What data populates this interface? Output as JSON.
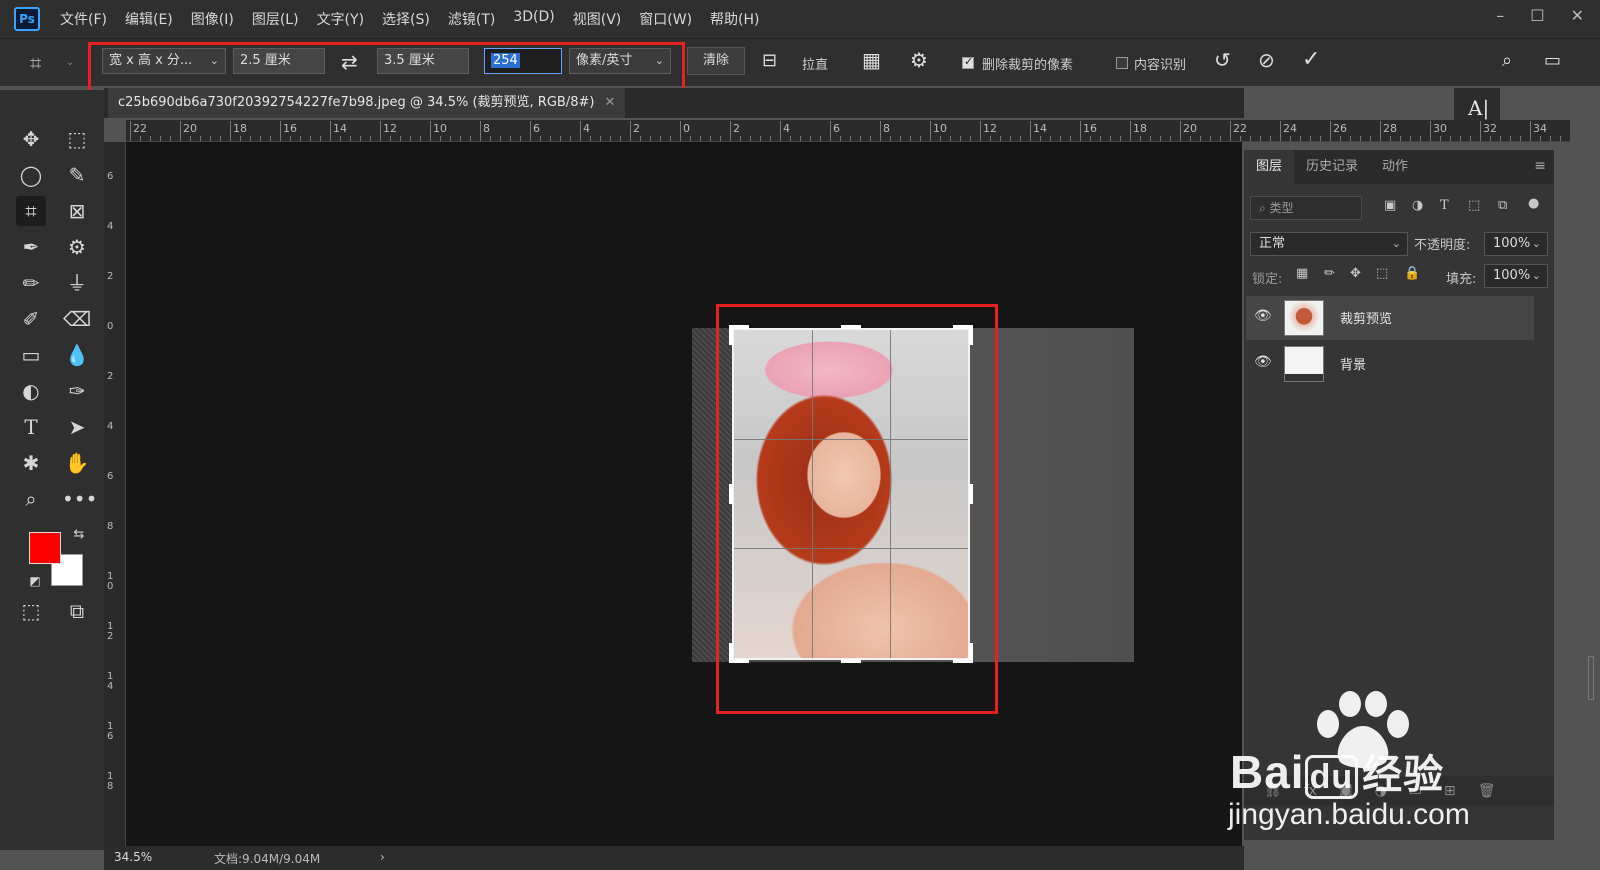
{
  "app": {
    "logo": "Ps"
  },
  "menu": [
    "文件(F)",
    "编辑(E)",
    "图像(I)",
    "图层(L)",
    "文字(Y)",
    "选择(S)",
    "滤镜(T)",
    "3D(D)",
    "视图(V)",
    "窗口(W)",
    "帮助(H)"
  ],
  "options": {
    "ratio_preset": "宽 x 高 x 分...",
    "width": "2.5 厘米",
    "height": "3.5 厘米",
    "resolution": "254",
    "resolution_unit": "像素/英寸",
    "clear_label": "清除",
    "straighten_label": "拉直",
    "delete_cropped_label": "删除裁剪的像素",
    "delete_cropped_checked": true,
    "content_aware_label": "内容识别",
    "content_aware_checked": false
  },
  "document": {
    "tab_title": "c25b690db6a730f20392754227fe7b98.jpeg  @  34.5% (裁剪预览, RGB/8#)"
  },
  "ruler_top_labels": [
    "22",
    "20",
    "18",
    "16",
    "14",
    "12",
    "10",
    "8",
    "6",
    "4",
    "2",
    "0",
    "2",
    "4",
    "6",
    "8",
    "10",
    "12",
    "14",
    "16",
    "18",
    "20",
    "22",
    "24",
    "26",
    "28",
    "30",
    "32",
    "34"
  ],
  "ruler_left_labels": [
    "6",
    "4",
    "2",
    "0",
    "2",
    "4",
    "6",
    "8",
    "1 0",
    "1 2",
    "1 4",
    "1 6",
    "1 8"
  ],
  "colors": {
    "foreground": "#ff0000",
    "background": "#ffffff",
    "highlight": "#e52121"
  },
  "layers_panel": {
    "tabs": [
      "图层",
      "历史记录",
      "动作"
    ],
    "filter_placeholder": "类型",
    "blend_mode": "正常",
    "opacity_label": "不透明度:",
    "opacity_value": "100%",
    "lock_label": "锁定:",
    "fill_label": "填充:",
    "fill_value": "100%",
    "layers": [
      {
        "name": "裁剪预览",
        "selected": true
      },
      {
        "name": "背景",
        "selected": false
      }
    ]
  },
  "status": {
    "zoom": "34.5%",
    "doc_info": "文档:9.04M/9.04M"
  },
  "watermark": {
    "main": "Bai",
    "du": "du",
    "cn": "经验",
    "url": "jingyan.baidu.com"
  }
}
